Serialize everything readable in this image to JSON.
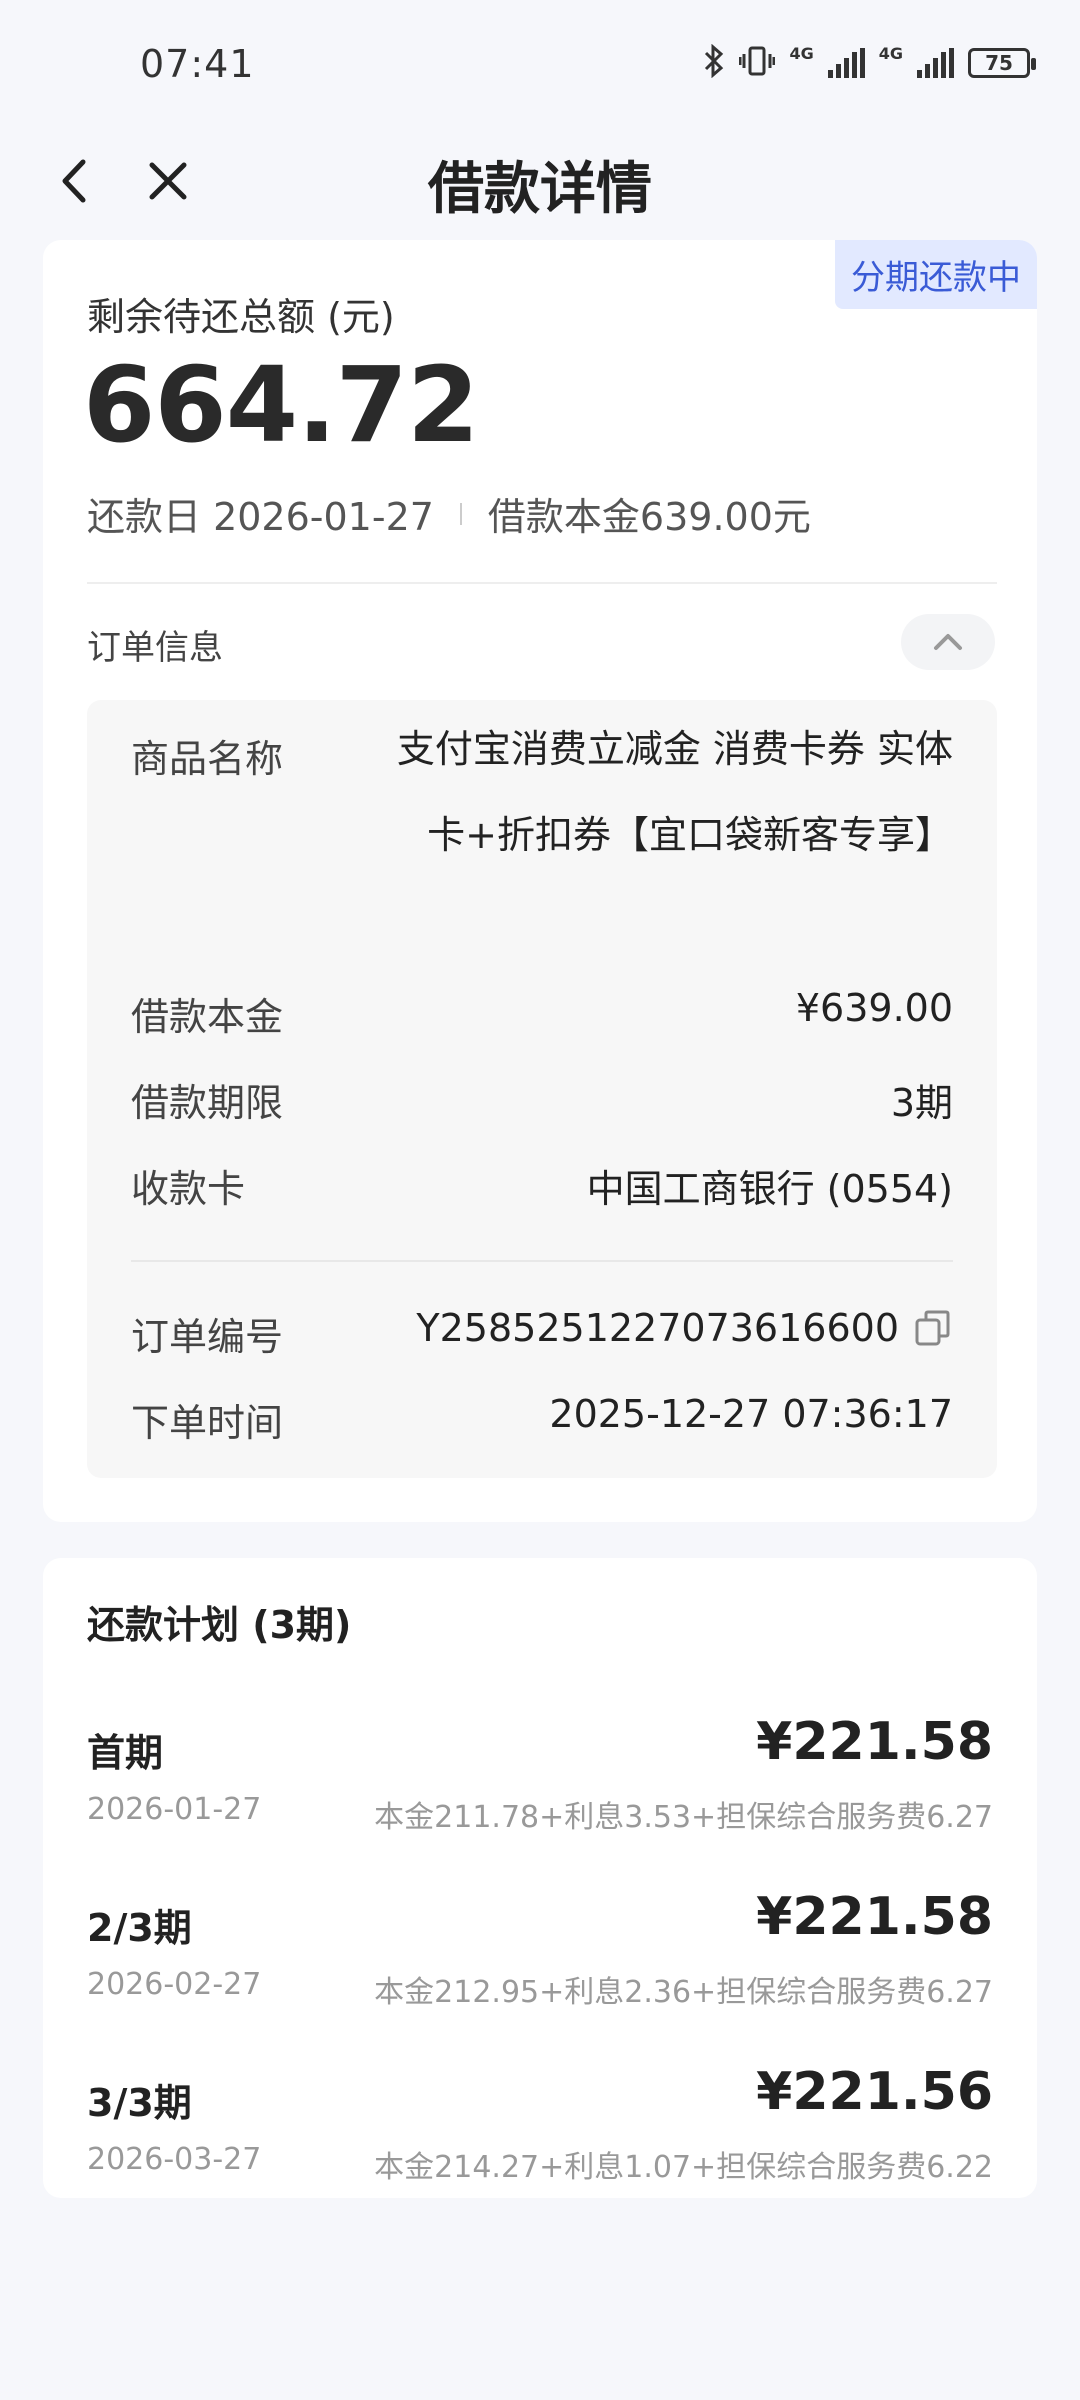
{
  "status_bar": {
    "time": "07:41",
    "battery": "75",
    "signal_1": "4G",
    "signal_2": "4G"
  },
  "header": {
    "title": "借款详情"
  },
  "summary": {
    "badge": "分期还款中",
    "remain_label": "剩余待还总额 (元)",
    "remain_amount": "664.72",
    "due_date_text": "还款日 2026-01-27",
    "principal_text": "借款本金639.00元"
  },
  "order_info": {
    "title": "订单信息",
    "product_label": "商品名称",
    "product_value": "支付宝消费立减金 消费卡券 实体卡+折扣券【宜口袋新客专享】",
    "principal_label": "借款本金",
    "principal_value": "¥639.00",
    "term_label": "借款期限",
    "term_value": "3期",
    "card_label": "收款卡",
    "card_value": "中国工商银行 (0554)",
    "order_no_label": "订单编号",
    "order_no_value": "Y2585251227073616600",
    "order_time_label": "下单时间",
    "order_time_value": "2025-12-27 07:36:17"
  },
  "plan": {
    "title": "还款计划 (3期)",
    "items": [
      {
        "period": "首期",
        "date": "2026-01-27",
        "amount": "¥221.58",
        "detail": "本金211.78+利息3.53+担保综合服务费6.27"
      },
      {
        "period": "2/3期",
        "date": "2026-02-27",
        "amount": "¥221.58",
        "detail": "本金212.95+利息2.36+担保综合服务费6.27"
      },
      {
        "period": "3/3期",
        "date": "2026-03-27",
        "amount": "¥221.56",
        "detail": "本金214.27+利息1.07+担保综合服务费6.22"
      }
    ]
  },
  "icons": {
    "back": "chevron-left-icon",
    "close": "close-icon",
    "collapse": "chevron-up-icon",
    "copy": "copy-icon",
    "bluetooth": "bluetooth-icon",
    "vibrate": "vibrate-icon"
  },
  "colors": {
    "badge_bg": "#e2e9ff",
    "badge_text": "#3a5bd6",
    "page_bg": "#f6f7fb"
  }
}
